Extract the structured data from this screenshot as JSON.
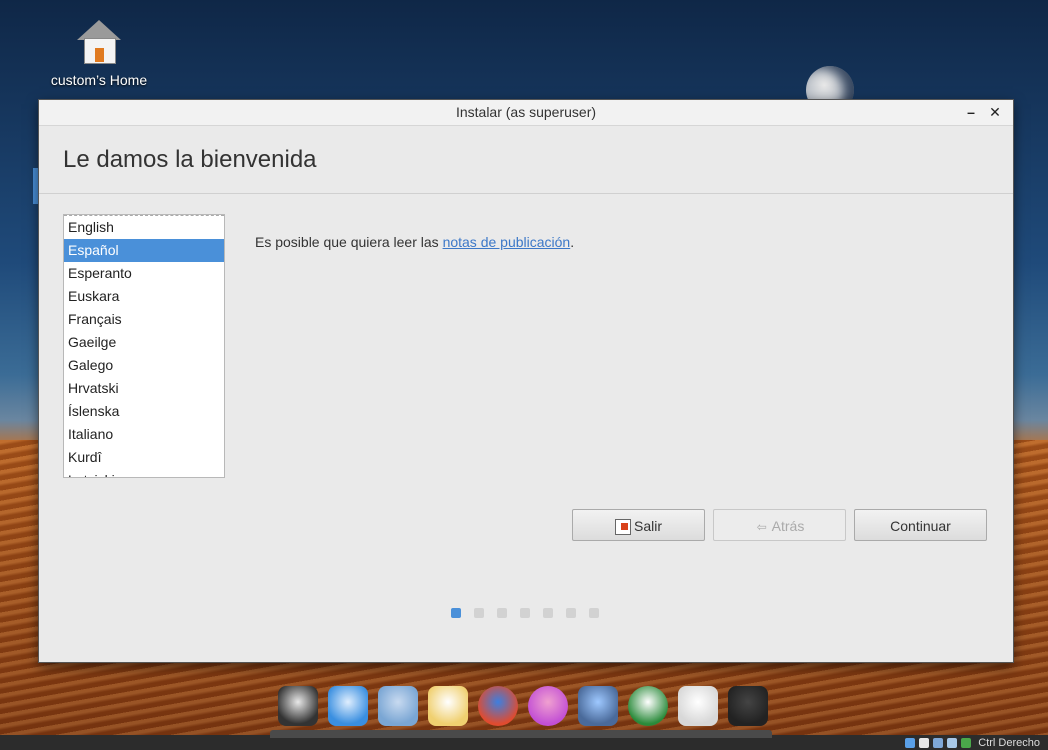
{
  "desktop": {
    "home_label": "custom’s Home"
  },
  "window": {
    "title": "Instalar (as superuser)",
    "minimize_glyph": "–",
    "close_glyph": "✕"
  },
  "header": {
    "title": "Le damos la bienvenida"
  },
  "languages": {
    "items": [
      "English",
      "Español",
      "Esperanto",
      "Euskara",
      "Français",
      "Gaeilge",
      "Galego",
      "Hrvatski",
      "Íslenska",
      "Italiano",
      "Kurdî",
      "Latviski"
    ],
    "selected": "Español"
  },
  "release": {
    "prefix": "Es posible que quiera leer las ",
    "link": "notas de publicación",
    "suffix": "."
  },
  "buttons": {
    "quit": "Salir",
    "back": "Atrás",
    "continue": "Continuar"
  },
  "progress": {
    "total_steps": 7,
    "current_step": 1
  },
  "dock": {
    "apps": [
      "terminal-icon",
      "files-icon",
      "folder-icon",
      "mail-icon",
      "chrome-icon",
      "music-icon",
      "video-editor-icon",
      "runner-icon",
      "trash-icon",
      "notes-icon"
    ]
  },
  "tray": {
    "label": "Ctrl Derecho"
  }
}
